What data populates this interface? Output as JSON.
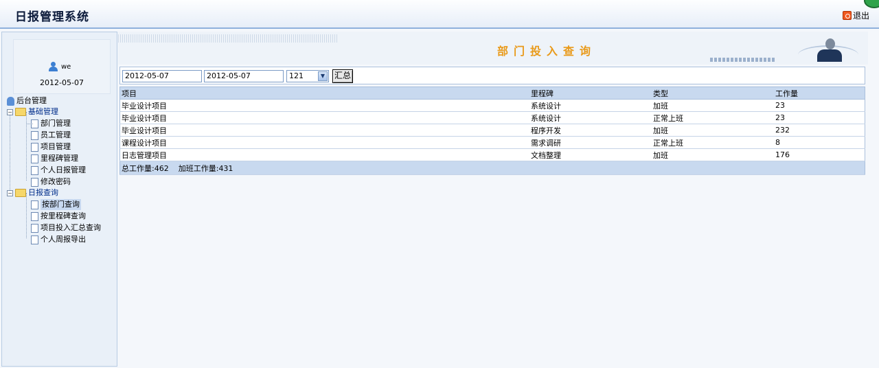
{
  "header": {
    "title": "日报管理系统",
    "logout_label": "退出"
  },
  "user": {
    "name": "we",
    "date": "2012-05-07"
  },
  "nav": {
    "root": "后台管理",
    "groups": [
      {
        "label": "基础管理",
        "items": [
          "部门管理",
          "员工管理",
          "项目管理",
          "里程碑管理",
          "个人日报管理",
          "修改密码"
        ]
      },
      {
        "label": "日报查询",
        "items": [
          "按部门查询",
          "按里程碑查询",
          "项目投入汇总查询",
          "个人周报导出"
        ]
      }
    ],
    "selected": "按部门查询"
  },
  "page": {
    "heading": "部门投入查询"
  },
  "filter": {
    "start_date": "2012-05-07",
    "end_date": "2012-05-07",
    "department": "121",
    "sum_button": "汇总"
  },
  "table": {
    "headers": [
      "项目",
      "里程碑",
      "类型",
      "工作量"
    ],
    "rows": [
      [
        "毕业设计项目",
        "系统设计",
        "加班",
        "23"
      ],
      [
        "毕业设计项目",
        "系统设计",
        "正常上班",
        "23"
      ],
      [
        "毕业设计项目",
        "程序开发",
        "加班",
        "232"
      ],
      [
        "课程设计项目",
        "需求调研",
        "正常上班",
        "8"
      ],
      [
        "日志管理项目",
        "文档整理",
        "加班",
        "176"
      ]
    ],
    "total_label": "总工作量",
    "total_value": "462",
    "overtime_label": "加班工作量",
    "overtime_value": "431"
  },
  "colors": {
    "heading": "#e99a1a",
    "accent": "#c8d9ef"
  }
}
